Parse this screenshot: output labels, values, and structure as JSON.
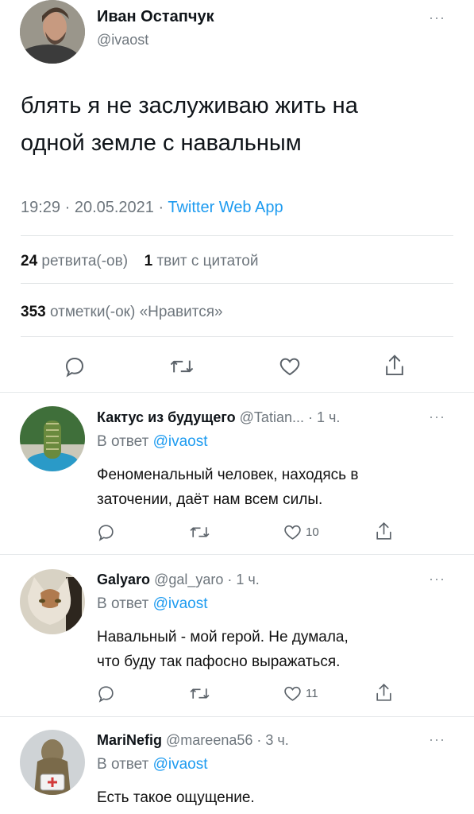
{
  "main_tweet": {
    "author_name": "Иван Остапчук",
    "author_handle": "@ivaost",
    "text_line1": "блять я не заслуживаю жить на",
    "text_line2": "одной земле с навальным",
    "time": "19:29 · 20.05.2021 · ",
    "client": "Twitter Web App",
    "retweets_count": "24",
    "retweets_label": "ретвита(-ов)",
    "quotes_count": "1",
    "quotes_label": "твит с цитатой",
    "likes_count": "353",
    "likes_label": "отметки(-ок) «Нравится»",
    "more_icon": "more-horizontal-icon"
  },
  "replies": [
    {
      "author_name": "Кактус из будущего",
      "author_handle": "@Tatian...",
      "time": "· 1 ч.",
      "reply_prefix": "В ответ",
      "reply_to": "@ivaost",
      "text_line1": "Феноменальный человек, находясь в",
      "text_line2": "заточении, даёт нам всем  силы.",
      "like_count": "10"
    },
    {
      "author_name": "Galyaro",
      "author_handle": "@gal_yaro",
      "time": "· 1 ч.",
      "reply_prefix": "В ответ",
      "reply_to": "@ivaost",
      "text_line1": "Навальный - мой герой. Не думала,",
      "text_line2": "что буду так пафосно выражаться.",
      "like_count": "11"
    },
    {
      "author_name": "MariNefig",
      "author_handle": "@mareena56",
      "time": "· 3 ч.",
      "reply_prefix": "В ответ",
      "reply_to": "@ivaost",
      "text_line1": "Есть такое ощущение."
    }
  ],
  "icons": {
    "reply": "reply-icon",
    "retweet": "retweet-icon",
    "like": "heart-icon",
    "share": "share-icon"
  },
  "colors": {
    "accent": "#1d9bf0",
    "secondary_text": "#6e767d",
    "divider": "#e6e9eb"
  }
}
